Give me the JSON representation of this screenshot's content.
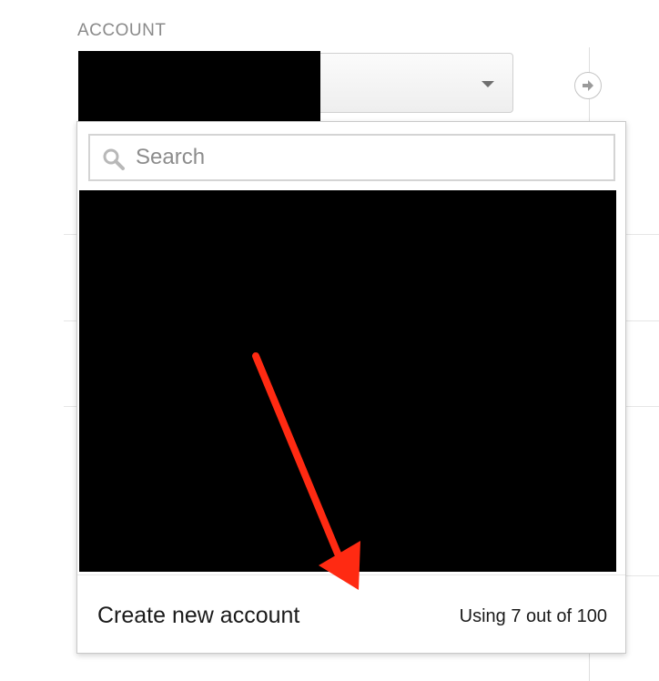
{
  "account": {
    "section_label": "ACCOUNT",
    "selected_value": "",
    "caret_icon": "chevron-down-icon"
  },
  "go_button": {
    "icon": "arrow-right-icon"
  },
  "dropdown": {
    "search": {
      "placeholder": "Search",
      "value": "",
      "icon": "search-icon"
    },
    "footer": {
      "create_label": "Create new account",
      "usage_text": "Using 7 out of 100"
    }
  },
  "annotation": {
    "arrow_color": "#ff2a12"
  },
  "colors": {
    "label_gray": "#8a8a8a",
    "border": "#c8c8c8",
    "text": "#1a1a1a"
  }
}
